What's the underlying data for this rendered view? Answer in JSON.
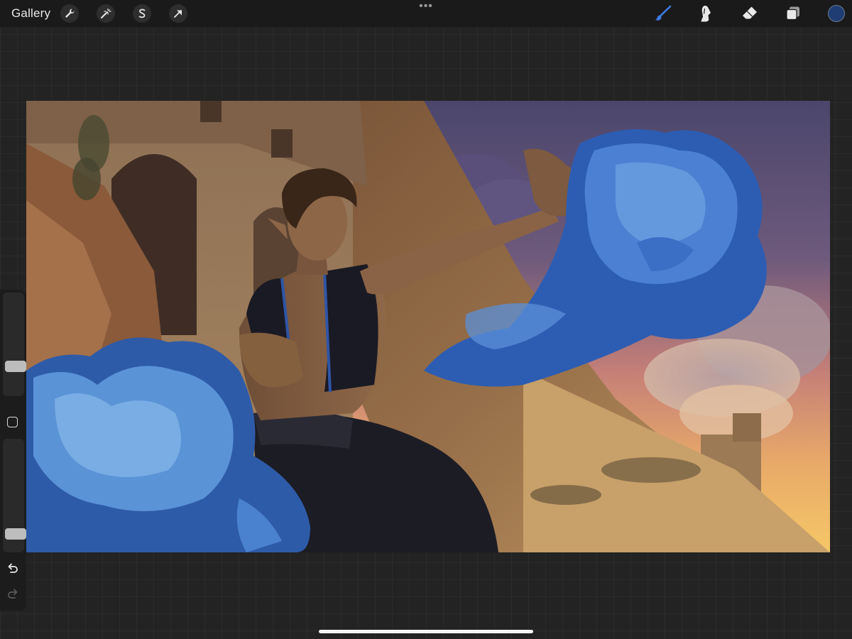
{
  "topbar": {
    "gallery_label": "Gallery",
    "left_tools": [
      "wrench-icon",
      "magic-wand-icon",
      "selection-s-icon",
      "transform-arrow-icon"
    ],
    "more_menu": "•••",
    "right_tools": [
      "brush-icon",
      "smudge-icon",
      "eraser-icon",
      "layers-icon"
    ],
    "active_tool": "brush-icon",
    "active_tool_color": "#3f7de6",
    "current_color": "#1f3d73"
  },
  "sidebar": {
    "brush_size_level": 0.25,
    "opacity_level": 0.1,
    "modify_button": "square-icon",
    "undo": "undo-arrow-icon",
    "redo": "redo-arrow-icon"
  },
  "canvas": {
    "content": "artwork-painting"
  }
}
